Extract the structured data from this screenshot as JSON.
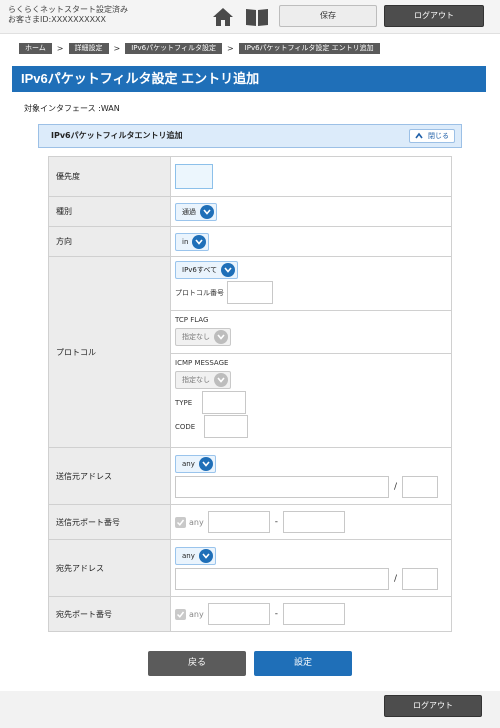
{
  "header": {
    "status_line1": "らくらくネットスタート設定済み",
    "status_line2": "お客さまID:XXXXXXXXXX",
    "save_label": "保存",
    "logout_label": "ログアウト",
    "home_icon": "home-icon",
    "manual_icon": "book-icon"
  },
  "breadcrumb": [
    "ホーム",
    "詳細設定",
    "IPv6パケットフィルタ設定",
    "IPv6パケットフィルタ設定 エントリ追加"
  ],
  "page_title": "IPv6パケットフィルタ設定 エントリ追加",
  "interface_line": "対象インタフェース :WAN",
  "panel": {
    "title": "IPv6パケットフィルタエントリ追加",
    "collapse_label": "閉じる"
  },
  "form": {
    "priority": {
      "label": "優先度",
      "value": ""
    },
    "type": {
      "label": "種別",
      "selected": "通過"
    },
    "direction": {
      "label": "方向",
      "selected": "in"
    },
    "protocol": {
      "label": "プロトコル",
      "selected": "IPv6すべて",
      "number_label": "プロトコル番号",
      "tcp_flag_label": "TCP FLAG",
      "tcp_flag_selected": "指定なし",
      "icmp_label": "ICMP MESSAGE",
      "icmp_selected": "指定なし",
      "type_label": "TYPE",
      "code_label": "CODE"
    },
    "src_address": {
      "label": "送信元アドレス",
      "selected": "any",
      "slash": "/"
    },
    "src_port": {
      "label": "送信元ポート番号",
      "any_label": "any",
      "dash": "-"
    },
    "dst_address": {
      "label": "宛先アドレス",
      "selected": "any",
      "slash": "/"
    },
    "dst_port": {
      "label": "宛先ポート番号",
      "any_label": "any",
      "dash": "-"
    }
  },
  "buttons": {
    "back_label": "戻る",
    "submit_label": "設定"
  },
  "footer": {
    "logout_label": "ログアウト"
  },
  "colors": {
    "accent": "#1f6fb8",
    "dark_button": "#4d4d4d",
    "panel_bg": "#dcebfa"
  }
}
